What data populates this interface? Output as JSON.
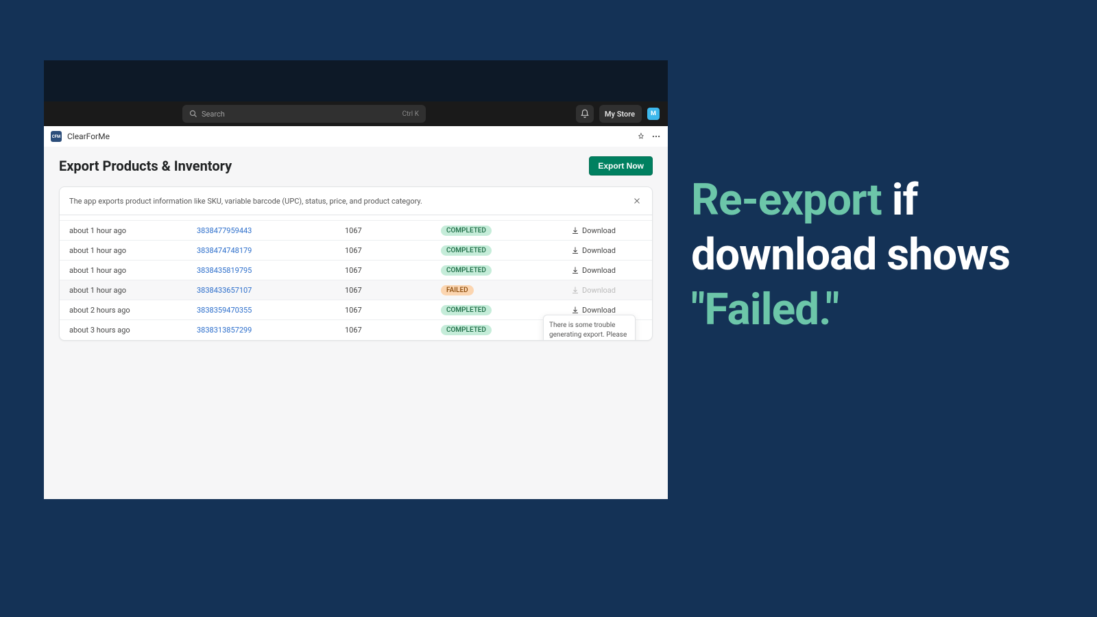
{
  "topbar": {
    "search_placeholder": "Search",
    "search_shortcut": "Ctrl K",
    "store_label": "My Store",
    "store_initials": "M"
  },
  "crumb": {
    "app_icon_text": "CFM",
    "app_name": "ClearForMe"
  },
  "page": {
    "title": "Export Products & Inventory",
    "export_button": "Export Now",
    "info_text": "The app exports product information like SKU, variable barcode (UPC), status, price, and product category."
  },
  "rows": [
    {
      "time": "about 1 hour ago",
      "id": "3838477959443",
      "count": "1067",
      "status": "COMPLETED",
      "download": "Download",
      "disabled": false,
      "hl": false
    },
    {
      "time": "about 1 hour ago",
      "id": "3838474748179",
      "count": "1067",
      "status": "COMPLETED",
      "download": "Download",
      "disabled": false,
      "hl": false
    },
    {
      "time": "about 1 hour ago",
      "id": "3838435819795",
      "count": "1067",
      "status": "COMPLETED",
      "download": "Download",
      "disabled": false,
      "hl": false
    },
    {
      "time": "about 1 hour ago",
      "id": "3838433657107",
      "count": "1067",
      "status": "FAILED",
      "download": "Download",
      "disabled": true,
      "hl": true
    },
    {
      "time": "about 2 hours ago",
      "id": "3838359470355",
      "count": "1067",
      "status": "COMPLETED",
      "download": "Download",
      "disabled": false,
      "hl": false
    },
    {
      "time": "about 3 hours ago",
      "id": "3838313857299",
      "count": "1067",
      "status": "COMPLETED",
      "download": "Download",
      "disabled": false,
      "hl": false
    }
  ],
  "tooltip": "There is some trouble generating export. Please Export again.",
  "callout": {
    "t1": "Re-export ",
    "t2": "if download shows ",
    "t3": "\"Failed.\""
  }
}
